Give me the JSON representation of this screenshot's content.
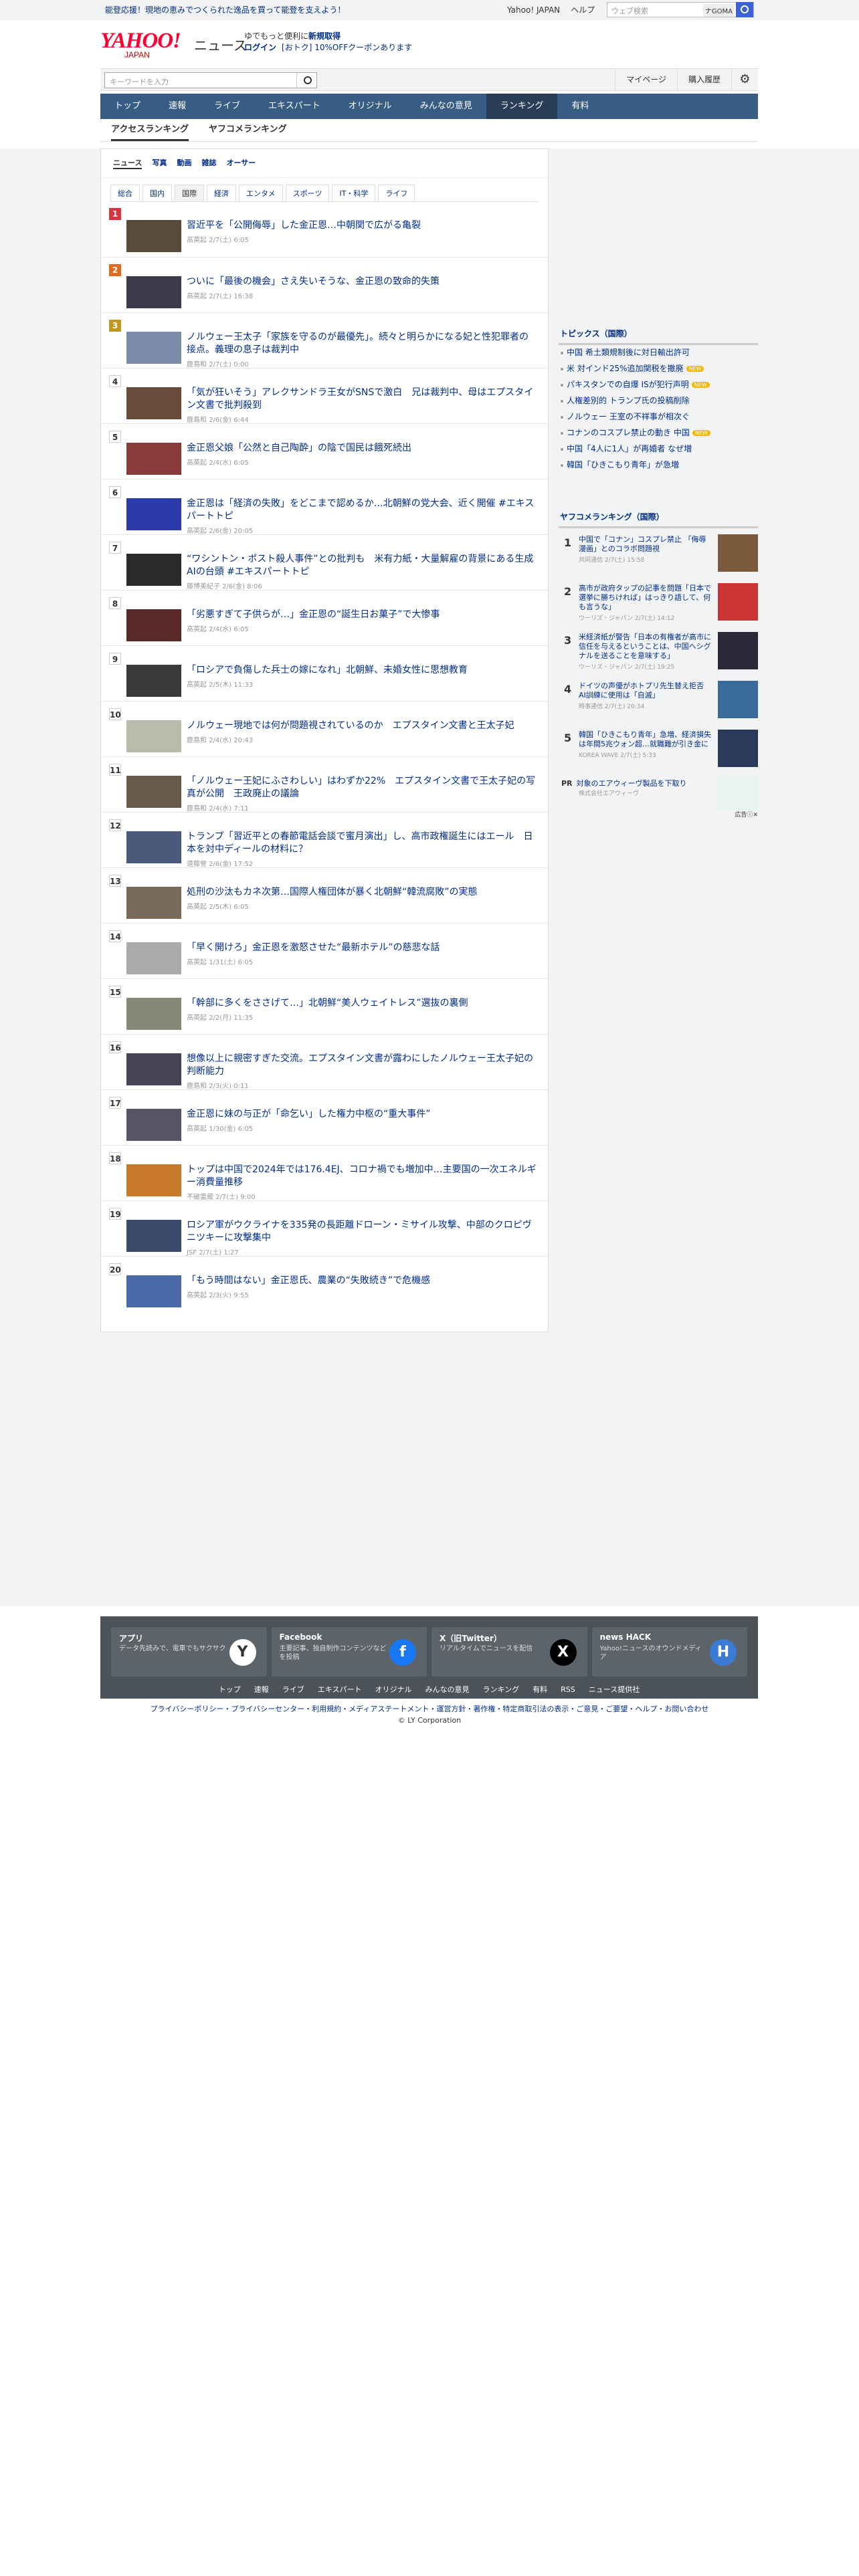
{
  "topbar": {
    "promo": "能登応援！現地の恵みでつくられた逸品を買って能登を支えよう！",
    "links": [
      "Yahoo! JAPAN",
      "ヘルプ"
    ],
    "search_placeholder": "ウェブ検索",
    "search_tag": "ナGOMA"
  },
  "header": {
    "logo": "YAHOO!",
    "logo_sub": "JAPAN",
    "section": "ニュース",
    "msg1": "ゆでもっと便利に",
    "msg1b": "新規取得",
    "login": "ログイン",
    "coupon": "[おトク] 10%OFFクーポンあります"
  },
  "search": {
    "placeholder": "キーワードを入力",
    "mypage": "マイページ",
    "history": "購入履歴"
  },
  "nav": [
    "トップ",
    "速報",
    "ライブ",
    "エキスパート",
    "オリジナル",
    "みんなの意見",
    "ランキング",
    "有料"
  ],
  "subtabs": [
    "アクセスランキング",
    "ヤフコメランキング"
  ],
  "cattabs": [
    "ニュース",
    "写真",
    "動画",
    "雑誌",
    "オーサー"
  ],
  "genres": [
    "総合",
    "国内",
    "国際",
    "経済",
    "エンタメ",
    "スポーツ",
    "IT・科学",
    "ライフ"
  ],
  "ranking": [
    {
      "rank": "1",
      "title": "習近平を「公開侮辱」した金正恩…中朝関で広がる亀裂",
      "source": "高英起",
      "date": "2/7(土) 6:05"
    },
    {
      "rank": "2",
      "title": "ついに「最後の機会」さえ失いそうな、金正恩の致命的失策",
      "source": "高英起",
      "date": "2/7(土) 16:38"
    },
    {
      "rank": "3",
      "title": "ノルウェー王太子「家族を守るのが最優先」。続々と明らかになる妃と性犯罪者の接点。義理の息子は裁判中",
      "source": "鹿島和",
      "date": "2/7(土) 0:00"
    },
    {
      "rank": "4",
      "title": "「気が狂いそう」アレクサンドラ王女がSNSで激白　兄は裁判中、母はエプスタイン文書で批判殺到",
      "source": "鹿島和",
      "date": "2/6(金) 6:44"
    },
    {
      "rank": "5",
      "title": "金正恩父娘「公然と自己陶酔」の陰で国民は餓死続出",
      "source": "高英起",
      "date": "2/4(水) 6:05"
    },
    {
      "rank": "6",
      "title": "金正恩は「経済の失敗」をどこまで認めるか…北朝鮮の党大会、近く開催 #エキスパートトピ",
      "source": "高英起",
      "date": "2/6(金) 20:05"
    },
    {
      "rank": "7",
      "title": "“ワシントン・ポスト殺人事件”との批判も　米有力紙・大量解雇の背景にある生成AIの台頭 #エキスパートトピ",
      "source": "藤博美紀子",
      "date": "2/6(金) 8:06"
    },
    {
      "rank": "8",
      "title": "「劣悪すぎて子供らが…」金正恩の“誕生日お菓子”で大惨事",
      "source": "高英起",
      "date": "2/4(水) 6:05"
    },
    {
      "rank": "9",
      "title": "「ロシアで負傷した兵士の嫁になれ」北朝鮮、未婚女性に思想教育",
      "source": "高英起",
      "date": "2/5(木) 11:33"
    },
    {
      "rank": "10",
      "title": "ノルウェー現地では何が問題視されているのか　エプスタイン文書と王太子妃",
      "source": "鹿島和",
      "date": "2/4(水) 20:43"
    },
    {
      "rank": "11",
      "title": "「ノルウェー王妃にふさわしい」はわずか22%　エプスタイン文書で王太子妃の写真が公開　王政廃止の議論",
      "source": "鹿島和",
      "date": "2/4(水) 7:11"
    },
    {
      "rank": "12",
      "title": "トランプ「習近平との春節電話会談で蜜月演出」し、高市政権誕生にはエール　日本を対中ディールの材料に？",
      "source": "遠藤誉",
      "date": "2/6(金) 17:52"
    },
    {
      "rank": "13",
      "title": "処刑の沙汰もカネ次第…国際人権団体が暴く北朝鮮“韓流腐敗”の実態",
      "source": "高英起",
      "date": "2/5(木) 6:05"
    },
    {
      "rank": "14",
      "title": "「早く開けろ」金正恩を激怒させた“最新ホテル”の慈悲な話",
      "source": "高英起",
      "date": "1/31(土) 6:05"
    },
    {
      "rank": "15",
      "title": "「幹部に多くをささげて…」北朝鮮“美人ウェイトレス”選抜の裏側",
      "source": "高英起",
      "date": "2/2(月) 11:35"
    },
    {
      "rank": "16",
      "title": "想像以上に親密すぎた交流。エプスタイン文書が露わにしたノルウェー王太子妃の判断能力",
      "source": "鹿島和",
      "date": "2/3(火) 0:11"
    },
    {
      "rank": "17",
      "title": "金正恩に妹の与正が「命乞い」した権力中枢の“重大事件”",
      "source": "高英起",
      "date": "1/30(金) 6:05"
    },
    {
      "rank": "18",
      "title": "トップは中国で2024年では176.4EJ、コロナ禍でも増加中…主要国の一次エネルギー消費量推移",
      "source": "不破雷蔵",
      "date": "2/7(土) 9:00"
    },
    {
      "rank": "19",
      "title": "ロシア軍がウクライナを335発の長距離ドローン・ミサイル攻撃、中部のクロピヴニツキーに攻撃集中",
      "source": "JSF",
      "date": "2/7(土) 1:27"
    },
    {
      "rank": "20",
      "title": "「もう時間はない」金正恩氏、農業の“失敗続き”で危機感",
      "source": "高英起",
      "date": "2/3(火) 9:55"
    }
  ],
  "topics": {
    "heading": "トピックス（国際）",
    "items": [
      {
        "text": "中国 希土類規制後に対日輸出許可",
        "new": ""
      },
      {
        "text": "米 対インド25%追加関税を撤廃",
        "new": "NEW"
      },
      {
        "text": "パキスタンでの自爆 ISが犯行声明",
        "new": "NEW"
      },
      {
        "text": "人権差別的 トランプ氏の投稿削除",
        "new": ""
      },
      {
        "text": "ノルウェー 王室の不祥事が相次ぐ",
        "new": ""
      },
      {
        "text": "コナンのコスプレ禁止の動き 中国",
        "new": "NEW"
      },
      {
        "text": "中国「4人に1人」が再婚者 なぜ増",
        "new": ""
      },
      {
        "text": "韓国「ひきこもり青年」が急増",
        "new": ""
      }
    ]
  },
  "yahooko": {
    "heading": "ヤフコメランキング（国際）",
    "items": [
      {
        "rank": "1",
        "title": "中国で「コナン」コスプレ禁止 「侮辱漫画」とのコラボ問題視",
        "source": "共同通信",
        "date": "2/7(土) 15:58"
      },
      {
        "rank": "2",
        "title": "高市が政府タップの記事を問題「日本で選挙に勝ちければ」はっきり語して、何も言うな」",
        "source": "ウーリズ・ジャパン",
        "date": "2/7(土) 14:12"
      },
      {
        "rank": "3",
        "title": "米経済紙が警告「日本の有権者が高市に信任を与えるということは、中国へシグナルを送ることを意味する」",
        "source": "ウーリズ・ジャパン",
        "date": "2/7(土) 19:25"
      },
      {
        "rank": "4",
        "title": "ドイツの声優がホトプリ先生替え拒否　AI訓練に使用は「自滅」",
        "source": "時事通信",
        "date": "2/7(土) 20:34"
      },
      {
        "rank": "5",
        "title": "韓国「ひきこもり青年」急増、経済損失は年間5兆ウォン超…就職難が引き金に",
        "source": "KOREA WAVE",
        "date": "2/7(土) 5:33"
      }
    ],
    "pr": {
      "label": "PR",
      "title": "対象のエアウィーヴ製品を下取り",
      "sponsor": "株式会社エアウィーヴ",
      "mark": "広告ⓘ✕"
    }
  },
  "footer": {
    "apps": [
      {
        "title": "アプリ",
        "desc": "データ先読みで、電車でもサクサク",
        "icon": "Y"
      },
      {
        "title": "Facebook",
        "desc": "主要記事、独自制作コンテンツなどを投稿",
        "icon": "f"
      },
      {
        "title": "X（旧Twitter）",
        "desc": "リアルタイムでニュースを配信",
        "icon": "X"
      },
      {
        "title": "news HACK",
        "desc": "Yahoo!ニュースのオウンドメディア",
        "icon": "H"
      }
    ],
    "links": [
      "トップ",
      "速報",
      "ライブ",
      "エキスパート",
      "オリジナル",
      "みんなの意見",
      "ランキング",
      "有料",
      "RSS",
      "ニュース提供社"
    ],
    "legal": "プライバシーポリシー・プライバシーセンター・利用規約・メディアステートメント・運営方針・著作権・特定商取引法の表示・ご意見・ご要望・ヘルプ・お問い合わせ",
    "copyright": "© LY Corporation"
  },
  "colors": {
    "link": "#002d8a",
    "nav": "#375d84",
    "nav_active": "#293d56",
    "rank1": "#d9343d",
    "rank2": "#de6b1f",
    "rank3": "#c19a1b"
  }
}
